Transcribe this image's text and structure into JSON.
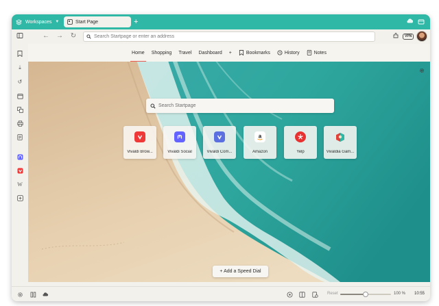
{
  "tabbar": {
    "workspaces_label": "Workspaces",
    "active_tab_title": "Start Page",
    "new_tab_symbol": "+",
    "accent_color": "#2fb8a6"
  },
  "address_bar": {
    "placeholder": "Search Startpage or enter an address",
    "vpn_label": "VPN"
  },
  "startpage_nav": {
    "items": [
      {
        "label": "Home",
        "active": true
      },
      {
        "label": "Shopping"
      },
      {
        "label": "Travel"
      },
      {
        "label": "Dashboard"
      },
      {
        "label": "+"
      },
      {
        "label": "Bookmarks",
        "icon": "bookmark-icon"
      },
      {
        "label": "History",
        "icon": "history-icon"
      },
      {
        "label": "Notes",
        "icon": "notes-icon"
      }
    ]
  },
  "search": {
    "placeholder": "Search Startpage"
  },
  "speed_dials": [
    {
      "label": "Vivaldi Brow...",
      "icon": "vivaldi-logo",
      "color": "#ef3939"
    },
    {
      "label": "Vivaldi Social",
      "icon": "mastodon-logo",
      "color": "#6364ff"
    },
    {
      "label": "Vivaldi Com...",
      "icon": "vivaldi-logo",
      "color": "#5b6fe0"
    },
    {
      "label": "Amazon",
      "icon": "amazon-logo",
      "color": "#ffffff"
    },
    {
      "label": "Yelp",
      "icon": "yelp-logo",
      "color": "#e83232"
    },
    {
      "label": "Vivaldia Gam...",
      "icon": "vivaldia-logo",
      "color": "#2fb8a6"
    }
  ],
  "add_speed_dial_label": "+ Add a Speed Dial",
  "statusbar": {
    "reset_label": "Reset",
    "zoom_value": "100 %",
    "zoom_level": 0.5,
    "clock": "10:55"
  }
}
